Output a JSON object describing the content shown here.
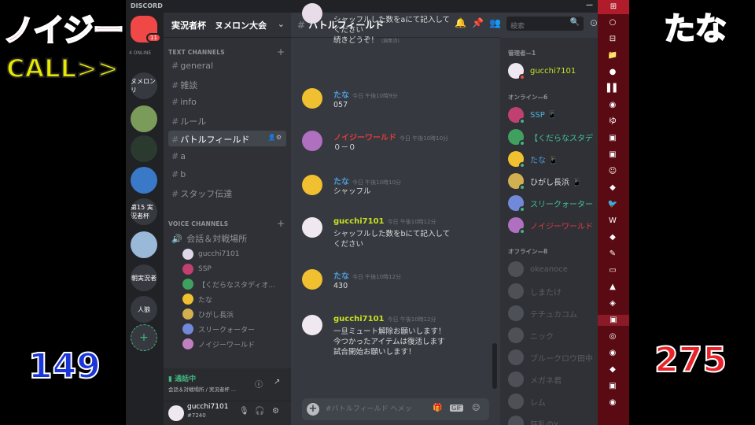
{
  "overlay": {
    "left_name": "ノイジー",
    "call": "CALL>>",
    "right_name": "たな",
    "left_score": "149",
    "right_score": "275"
  },
  "app": {
    "title": "DISCORD",
    "minimize": "—"
  },
  "guilds": {
    "badge": "11",
    "online_label": "4 ONLINE",
    "items": [
      {
        "label": "",
        "color": "#f04747"
      },
      {
        "label": "ヌメロンリ",
        "color": "#36393f"
      },
      {
        "label": "",
        "color": "#7a9b5a"
      },
      {
        "label": "",
        "color": "#2a3a2e"
      },
      {
        "label": "",
        "color": "#3a78c8"
      },
      {
        "label": "第15 実況者杯",
        "color": "#36393f"
      },
      {
        "label": "",
        "color": "#9ab8d8"
      },
      {
        "label": "朝実況者",
        "color": "#36393f"
      },
      {
        "label": "人狼",
        "color": "#36393f"
      },
      {
        "label": "+",
        "color": "#36393f"
      }
    ]
  },
  "server": {
    "name": "実況者杯　ヌメロン大会",
    "chevron": "⌄"
  },
  "text_category": {
    "label": "TEXT CHANNELS",
    "add": "+"
  },
  "text_channels": [
    {
      "name": "general"
    },
    {
      "name": "雑談"
    },
    {
      "name": "info"
    },
    {
      "name": "ルール"
    },
    {
      "name": "バトルフィールド"
    },
    {
      "name": "a"
    },
    {
      "name": "b"
    },
    {
      "name": "スタッフ伝達"
    }
  ],
  "active_channel_actions": "👤⚙",
  "voice_category": {
    "label": "VOICE CHANNELS",
    "add": "+"
  },
  "voice_channel": {
    "name": "会話＆対戦場所"
  },
  "voice_users": [
    {
      "name": "gucchi7101",
      "color": "#e0d8e8"
    },
    {
      "name": "SSP",
      "color": "#c04070"
    },
    {
      "name": "【くだらなスタディオ...",
      "color": "#40a060"
    },
    {
      "name": "たな",
      "color": "#f0c030"
    },
    {
      "name": "ひがし長浜",
      "color": "#d0b050"
    },
    {
      "name": "スリークォーター",
      "color": "#7289da"
    },
    {
      "name": "ノイジーワールド",
      "color": "#c080c0"
    }
  ],
  "voice_panel": {
    "status": "通話中",
    "sub": "会話＆対戦場所 / 実況者杯 ...",
    "info": "ⓘ",
    "disconnect": "↗"
  },
  "user_panel": {
    "name": "gucchi7101",
    "tag": "#7240",
    "mic": "🎙",
    "headset": "🎧",
    "settings": "⚙"
  },
  "chat_header": {
    "channel": "バトルフィールド",
    "bell": "🔔",
    "pin": "📌",
    "members": "👥",
    "search_placeholder": "検索",
    "search_icon": "🔍",
    "more": "⊙"
  },
  "messages": [
    {
      "author": "",
      "time": "",
      "lines": [
        "シャッフルした数をaにて記入して",
        "ください",
        "続きどうぞ！"
      ],
      "edited": "(編集済)",
      "color": "#ffffff",
      "av": "#e8dce8",
      "partial": true
    },
    {
      "author": "たな",
      "time": "今日 午後10時9分",
      "lines": [
        "057"
      ],
      "color": "#4f9cdb",
      "av": "#f0c030"
    },
    {
      "author": "ノイジーワールド",
      "time": "今日 午後10時10分",
      "lines": [
        "０－０"
      ],
      "color": "#e03c3c",
      "av": "#b070c0"
    },
    {
      "author": "たな",
      "time": "今日 午後10時10分",
      "lines": [
        "シャッフル"
      ],
      "color": "#4f9cdb",
      "av": "#f0c030"
    },
    {
      "author": "gucchi7101",
      "time": "今日 午後10時12分",
      "lines": [
        "シャッフルした数をbにて記入して",
        "ください"
      ],
      "color": "#c8e020",
      "av": "#f0e8f0"
    },
    {
      "author": "たな",
      "time": "今日 午後10時12分",
      "lines": [
        "430"
      ],
      "color": "#4f9cdb",
      "av": "#f0c030"
    },
    {
      "author": "gucchi7101",
      "time": "今日 午後10時12分",
      "lines": [
        "一旦ミュート解除お願いします！",
        "今つかったアイテムは復活します",
        "試合開始お願いします！"
      ],
      "color": "#c8e020",
      "av": "#f0e8f0"
    }
  ],
  "composer": {
    "plus": "+",
    "placeholder": "#バトルフィールド へメッ",
    "gift": "🎁",
    "gif": "GIF",
    "emoji": "☺"
  },
  "members": {
    "admin_header": "管理者—1",
    "online_header": "オンライン—6",
    "offline_header": "オフライン—8",
    "admin": [
      {
        "name": "gucchi7101",
        "color": "#c8e020",
        "av": "#f0e8f0",
        "status": "#f04747"
      }
    ],
    "online": [
      {
        "name": "SSP 📱",
        "color": "#4fb3d8",
        "av": "#c04070",
        "status": "#43b581"
      },
      {
        "name": "【くだらなスタデ",
        "color": "#43c0a0",
        "av": "#40a060",
        "status": "#43b581"
      },
      {
        "name": "たな 📱",
        "color": "#4f9cdb",
        "av": "#f0c030",
        "status": "#43b581"
      },
      {
        "name": "ひがし長浜 📱",
        "color": "#dcddde",
        "av": "#d0b050",
        "status": "#43b581"
      },
      {
        "name": "スリークォーター",
        "color": "#43c0a0",
        "av": "#7289da",
        "status": "#43b581"
      },
      {
        "name": "ノイジーワールド",
        "color": "#e03c3c",
        "av": "#b070c0",
        "status": "#43b581"
      }
    ],
    "offline": [
      {
        "name": "okeanoce",
        "av": "#72767d"
      },
      {
        "name": "しまたけ",
        "av": "#72767d"
      },
      {
        "name": "テチュカコム",
        "av": "#72767d"
      },
      {
        "name": "ニック",
        "av": "#72767d"
      },
      {
        "name": "ブルークロウ田中",
        "av": "#72767d"
      },
      {
        "name": "メガネ君",
        "av": "#72767d"
      },
      {
        "name": "レム",
        "av": "#72767d"
      },
      {
        "name": "狂乱のY",
        "av": "#72767d"
      }
    ]
  },
  "taskbar": {
    "start": "⊞",
    "icons": [
      "○",
      "⊟",
      "📁",
      "●",
      "▌▌",
      "◉",
      "ゆ",
      "▣",
      "▣",
      "☺",
      "◆",
      "🐦",
      "W",
      "◆",
      "✎",
      "▭",
      "▲",
      "◈",
      "▣",
      "◎",
      "◉",
      "◆",
      "▣",
      "◉"
    ],
    "active_index": 18
  }
}
